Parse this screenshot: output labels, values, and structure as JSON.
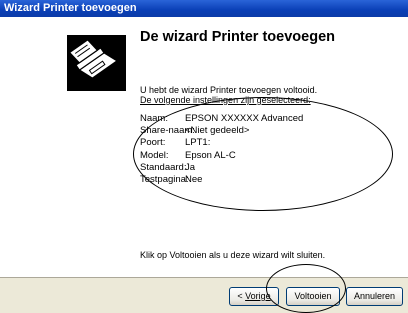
{
  "window": {
    "title": "Wizard Printer toevoegen"
  },
  "sidebar": {
    "icon": "printer-icon"
  },
  "content": {
    "heading": "De wizard Printer toevoegen",
    "intro_line1": "U hebt de wizard Printer toevoegen voltooid.",
    "intro_line2": "De volgende instellingen zijn geselecteerd:",
    "settings": [
      {
        "label": "Naam:",
        "value": "EPSON XXXXXX Advanced"
      },
      {
        "label": "Share-naam:",
        "value": "<Niet gedeeld>"
      },
      {
        "label": "Poort:",
        "value": "LPT1:"
      },
      {
        "label": "Model:",
        "value": "Epson AL-C"
      },
      {
        "label": "Standaard:",
        "value": "Ja"
      },
      {
        "label": "Testpagina:",
        "value": "Nee"
      }
    ],
    "finish_note": "Klik op Voltooien als u deze wizard wilt sluiten."
  },
  "buttons": {
    "back_prefix": "< ",
    "back_label": "Vorige",
    "finish_label": "Voltooien",
    "cancel_label": "Annuleren"
  }
}
